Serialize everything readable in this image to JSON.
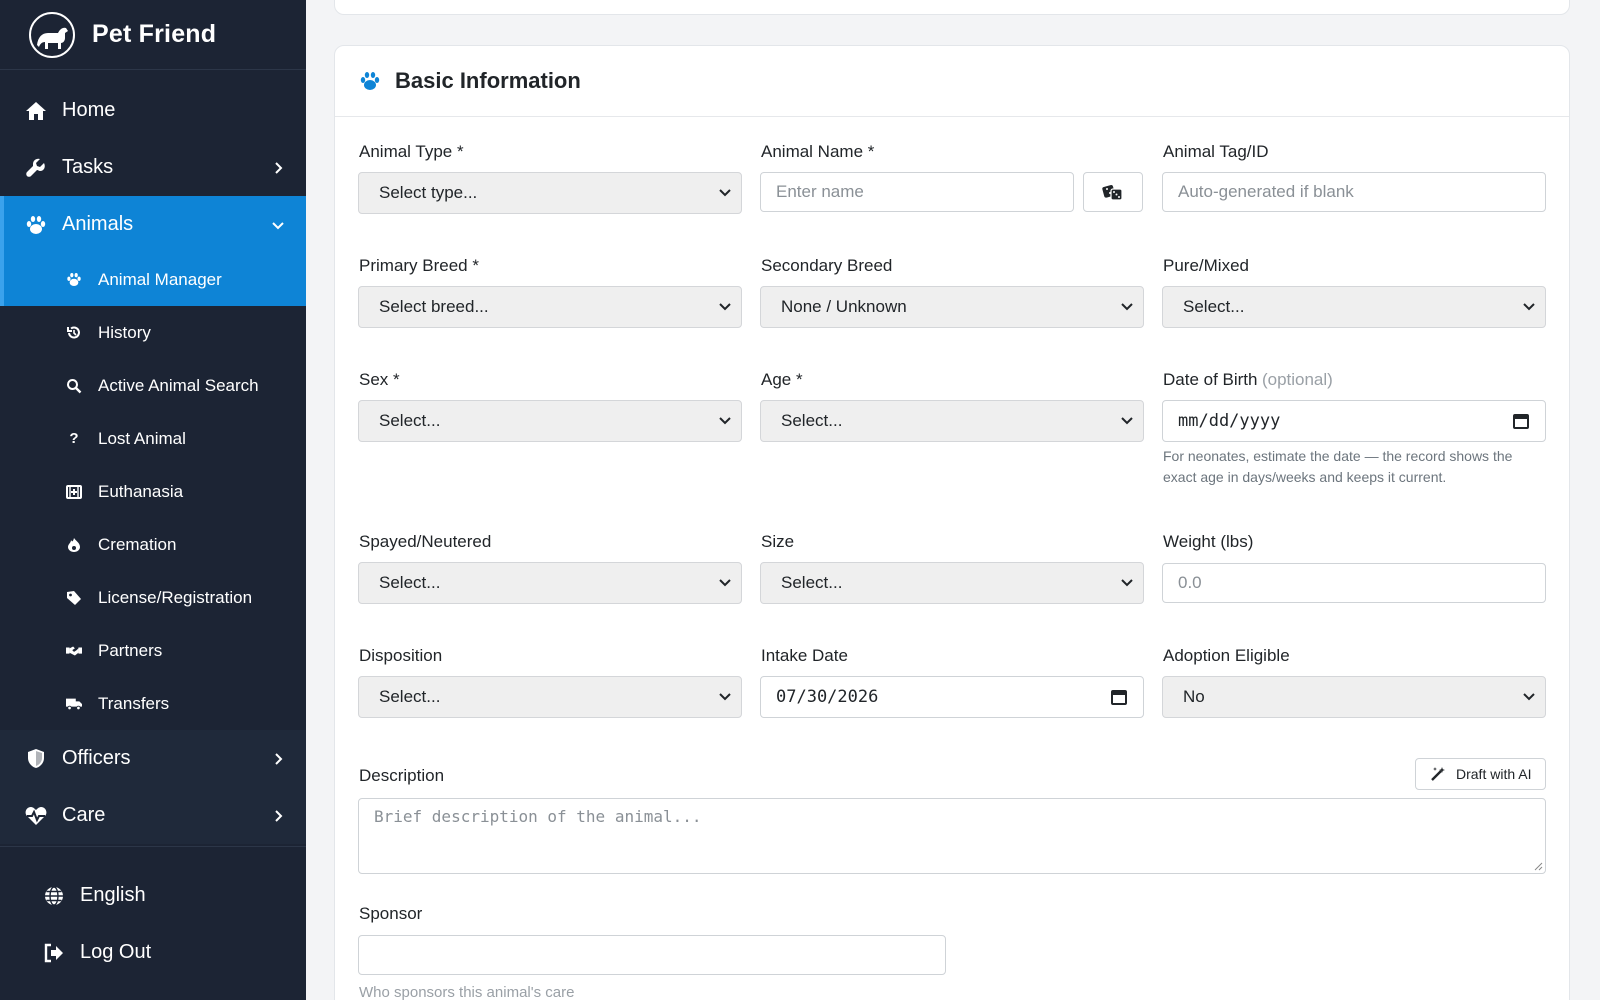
{
  "brand": {
    "name": "Pet Friend",
    "logo_icon": "dog-logo-icon"
  },
  "sidebar": {
    "items": [
      {
        "label": "Home",
        "icon": "home-icon"
      },
      {
        "label": "Tasks",
        "icon": "wrench-icon"
      },
      {
        "label": "Animals",
        "icon": "paw-icon"
      }
    ],
    "animals_sub": [
      {
        "label": "Animal Manager",
        "icon": "paw-icon"
      },
      {
        "label": "History",
        "icon": "history-icon"
      },
      {
        "label": "Active Animal Search",
        "icon": "search-icon"
      },
      {
        "label": "Lost Animal",
        "icon": "question-icon",
        "glyph": "?"
      },
      {
        "label": "Euthanasia",
        "icon": "clinic-icon"
      },
      {
        "label": "Cremation",
        "icon": "fire-icon"
      },
      {
        "label": "License/Registration",
        "icon": "tag-icon"
      },
      {
        "label": "Partners",
        "icon": "handshake-icon"
      },
      {
        "label": "Transfers",
        "icon": "truck-icon"
      }
    ],
    "items_after": [
      {
        "label": "Officers",
        "icon": "shield-icon"
      },
      {
        "label": "Care",
        "icon": "heartbeat-icon"
      }
    ],
    "bottom": [
      {
        "label": "English",
        "icon": "globe-icon"
      },
      {
        "label": "Log Out",
        "icon": "logout-icon"
      }
    ]
  },
  "form": {
    "title": "Basic Information",
    "animal_type": {
      "label": "Animal Type *",
      "value": "Select type..."
    },
    "animal_name": {
      "label": "Animal Name *",
      "placeholder": "Enter name",
      "random_icon": "dice-icon"
    },
    "animal_tag": {
      "label": "Animal Tag/ID",
      "placeholder": "Auto-generated if blank"
    },
    "primary_breed": {
      "label": "Primary Breed *",
      "value": "Select breed..."
    },
    "secondary_breed": {
      "label": "Secondary Breed",
      "value": "None / Unknown"
    },
    "pure_mixed": {
      "label": "Pure/Mixed",
      "value": "Select..."
    },
    "sex": {
      "label": "Sex *",
      "value": "Select..."
    },
    "age": {
      "label": "Age *",
      "value": "Select..."
    },
    "dob": {
      "label": "Date of Birth",
      "optional": "(optional)",
      "value": "mm/dd/yyyy",
      "help": "For neonates, estimate the date — the record shows the exact age in days/weeks and keeps it current."
    },
    "spayed": {
      "label": "Spayed/Neutered",
      "value": "Select..."
    },
    "size": {
      "label": "Size",
      "value": "Select..."
    },
    "weight": {
      "label": "Weight (lbs)",
      "placeholder": "0.0"
    },
    "disposition": {
      "label": "Disposition",
      "value": "Select..."
    },
    "intake_date": {
      "label": "Intake Date",
      "value": "07/30/2026"
    },
    "adoption": {
      "label": "Adoption Eligible",
      "value": "No"
    },
    "description": {
      "label": "Description",
      "placeholder": "Brief description of the animal...",
      "ai_button": "Draft with AI"
    },
    "sponsor": {
      "label": "Sponsor",
      "help": "Who sponsors this animal's care"
    }
  },
  "colors": {
    "sidebar_bg": "#1c2434",
    "active": "#0e84d6",
    "accent": "#0e84d6"
  }
}
